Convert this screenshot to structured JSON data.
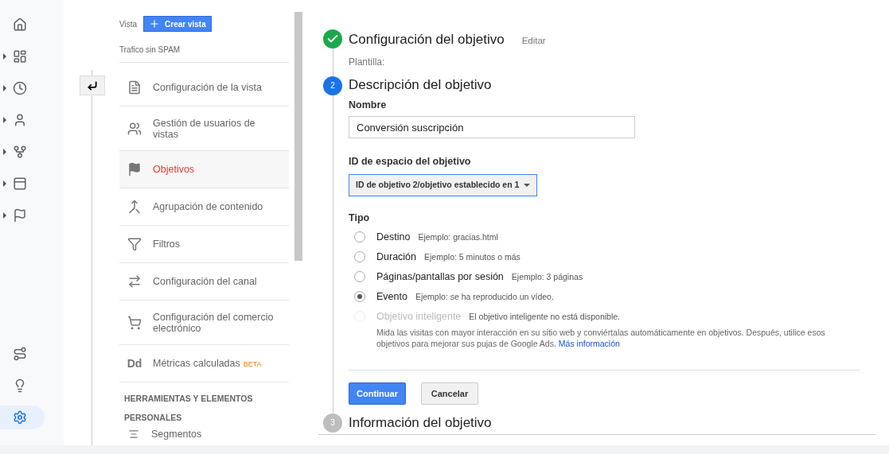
{
  "rail": {
    "top_items": [
      {
        "expandable": false
      },
      {
        "expandable": true
      },
      {
        "expandable": true
      },
      {
        "expandable": true
      },
      {
        "expandable": true
      },
      {
        "expandable": true
      },
      {
        "expandable": true
      }
    ],
    "bottom_items": [
      {
        "selected": false
      },
      {
        "selected": false
      },
      {
        "selected": true
      }
    ]
  },
  "admin": {
    "view_label": "Vista",
    "create_button": "Crear vista",
    "view_name": "Trafico sin SPAM",
    "items": [
      {
        "label": "Configuración de la vista",
        "selected": false
      },
      {
        "label": "Gestión de usuarios de vistas",
        "selected": false
      },
      {
        "label": "Objetivos",
        "selected": true
      },
      {
        "label": "Agrupación de contenido",
        "selected": false
      },
      {
        "label": "Filtros",
        "selected": false
      },
      {
        "label": "Configuración del canal",
        "selected": false
      },
      {
        "label": "Configuración del comercio electrónico",
        "selected": false
      },
      {
        "icon_text": "Dd",
        "label": "Métricas calculadas",
        "badge": "BETA",
        "selected": false
      }
    ],
    "section_title": "HERRAMIENTAS Y ELEMENTOS PERSONALES",
    "section_items": [
      {
        "label": "Segmentos"
      }
    ]
  },
  "steps": [
    {
      "done": true,
      "active": false,
      "title": "Configuración del objetivo",
      "edit": "Editar",
      "subtitle": "Plantilla:"
    },
    {
      "done": false,
      "active": true,
      "number": "2",
      "title": "Descripción del objetivo"
    },
    {
      "done": false,
      "active": false,
      "number": "3",
      "title": "Información del objetivo"
    }
  ],
  "form": {
    "name_label": "Nombre",
    "name_value": "Conversión suscripción",
    "slot_label": "ID de espacio del objetivo",
    "slot_value": "ID de objetivo 2/objetivo establecido en 1",
    "type_label": "Tipo",
    "types": [
      {
        "label": "Destino",
        "example": "Ejemplo: gracias.html",
        "selected": false,
        "disabled": false
      },
      {
        "label": "Duración",
        "example": "Ejemplo: 5 minutos o más",
        "selected": false,
        "disabled": false
      },
      {
        "label": "Páginas/pantallas por sesión",
        "example": "Ejemplo: 3 páginas",
        "selected": false,
        "disabled": false
      },
      {
        "label": "Evento",
        "example": "Ejemplo: se ha reproducido un vídeo.",
        "selected": true,
        "disabled": false
      },
      {
        "label": "Objetivo inteligente",
        "example": "El objetivo inteligente no está disponible.",
        "selected": false,
        "disabled": true
      }
    ],
    "smart_description": "Mida las visitas con mayor interacción en su sitio web y conviértalas automáticamente en objetivos. Después, utilice esos objetivos para mejorar sus pujas de Google Ads.",
    "smart_link": "Más información",
    "continue_button": "Continuar",
    "cancel_button": "Cancelar"
  }
}
